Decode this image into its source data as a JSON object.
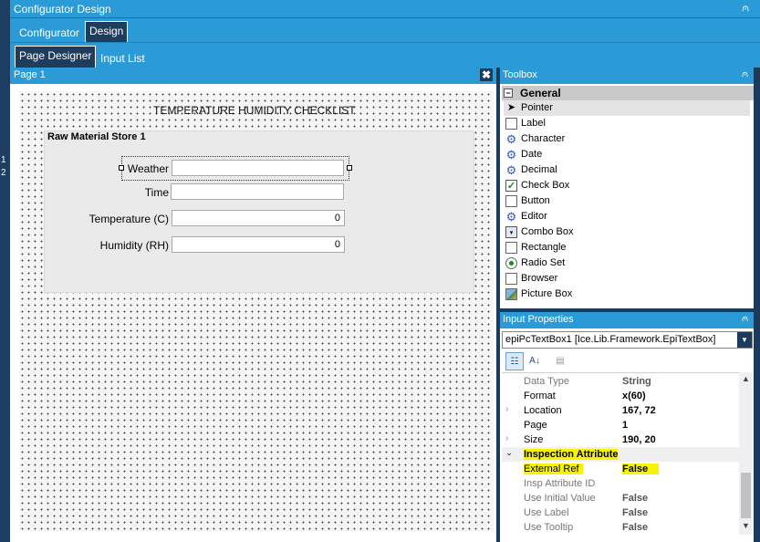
{
  "window": {
    "title": "Configurator Design",
    "pin": "⩀"
  },
  "left_strip": {
    "marks": [
      "1",
      "2"
    ]
  },
  "tabs_primary": [
    {
      "label": "Configurator"
    },
    {
      "label": "Design"
    }
  ],
  "tabs_secondary": [
    {
      "label": "Page Designer"
    },
    {
      "label": "Input List"
    }
  ],
  "designer": {
    "page_title": "Page 1",
    "close_glyph": "✖",
    "form_title": "TEMPERATURE  HUMIDITY CHECKLIST",
    "group_title": "Raw Material Store 1",
    "fields": [
      {
        "label": "Weather",
        "value": ""
      },
      {
        "label": "Time",
        "value": ""
      },
      {
        "label": "Temperature (C)",
        "value": "0"
      },
      {
        "label": "Humidity (RH)",
        "value": "0"
      }
    ]
  },
  "toolbox": {
    "title": "Toolbox",
    "group": "General",
    "items": [
      {
        "label": "Pointer",
        "icon": "pointer-icon"
      },
      {
        "label": "Label",
        "icon": "label-icon"
      },
      {
        "label": "Character",
        "icon": "gear-icon"
      },
      {
        "label": "Date",
        "icon": "gear-icon"
      },
      {
        "label": "Decimal",
        "icon": "gear-icon"
      },
      {
        "label": "Check Box",
        "icon": "checkbox-icon"
      },
      {
        "label": "Button",
        "icon": "button-icon"
      },
      {
        "label": "Editor",
        "icon": "gear-icon"
      },
      {
        "label": "Combo Box",
        "icon": "combo-icon"
      },
      {
        "label": "Rectangle",
        "icon": "rectangle-icon"
      },
      {
        "label": "Radio Set",
        "icon": "radio-icon"
      },
      {
        "label": "Browser",
        "icon": "browser-icon"
      },
      {
        "label": "Picture Box",
        "icon": "picture-icon"
      }
    ]
  },
  "properties": {
    "title": "Input Properties",
    "object": "epiPcTextBox1 [Ice.Lib.Framework.EpiTextBox]",
    "rows": [
      {
        "name": "Data Type",
        "value": "String"
      },
      {
        "name": "Format",
        "value": "x(60)"
      },
      {
        "name": "Location",
        "value": "167, 72"
      },
      {
        "name": "Page",
        "value": "1"
      },
      {
        "name": "Size",
        "value": "190, 20"
      },
      {
        "name": "Inspection Attribute",
        "value": ""
      },
      {
        "name": "External Ref",
        "value": "False"
      },
      {
        "name": "Insp Attribute ID",
        "value": ""
      },
      {
        "name": "Use Initial Value",
        "value": "False"
      },
      {
        "name": "Use Label",
        "value": "False"
      },
      {
        "name": "Use Tooltip",
        "value": "False"
      }
    ],
    "highlight_color": "#f8f300"
  },
  "colors": {
    "accent": "#2a9bd7",
    "dark": "#1b3a5c"
  }
}
